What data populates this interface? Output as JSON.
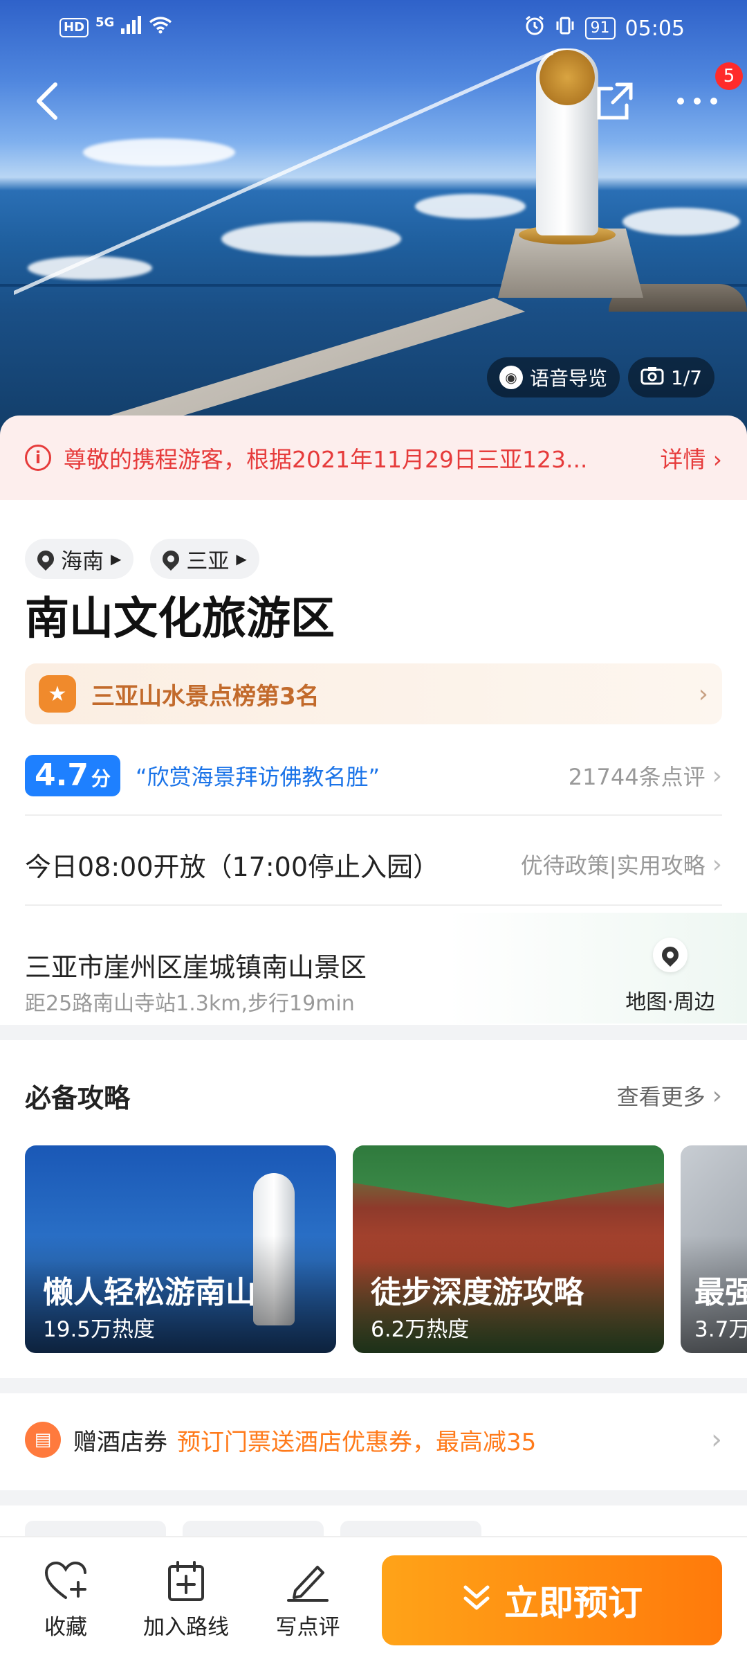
{
  "status_bar": {
    "left_badges": [
      "HD",
      "5G"
    ],
    "battery": "91",
    "time": "05:05"
  },
  "hero": {
    "notification_count": "5",
    "audio_guide_label": "语音导览",
    "photo_counter": "1/7"
  },
  "notice": {
    "text": "尊敬的携程游客，根据2021年11月29日三亚123...",
    "detail_label": "详情"
  },
  "location": {
    "province": "海南",
    "city": "三亚"
  },
  "attraction": {
    "title": "南山文化旅游区",
    "rank_label": "三亚山水景点榜第3名",
    "score": "4.7",
    "score_unit": "分",
    "quote": "“欣赏海景拜访佛教名胜”",
    "reviews": "21744条点评"
  },
  "hours": {
    "text": "今日08:00开放（17:00停止入园）",
    "links": "优待政策|实用攻略"
  },
  "address": {
    "line1": "三亚市崖州区崖城镇南山景区",
    "line2": "距25路南山寺站1.3km,步行19min",
    "map_label": "地图·周边"
  },
  "guides": {
    "heading": "必备攻略",
    "more_label": "查看更多",
    "cards": [
      {
        "title": "懒人轻松游南山",
        "heat": "19.5万热度"
      },
      {
        "title": "徒步深度游攻略",
        "heat": "6.2万热度"
      },
      {
        "title": "最强",
        "heat": "3.7万"
      }
    ]
  },
  "hotel_coupon": {
    "label": "赠酒店券",
    "promo": "预订门票送酒店优惠券，最高减35"
  },
  "bottom_bar": {
    "favorite": "收藏",
    "add_route": "加入路线",
    "write_review": "写点评",
    "book_now": "立即预订"
  },
  "colors": {
    "accent_orange": "#ff8a0d",
    "score_blue": "#1e80ff",
    "notice_red": "#e63b3b"
  }
}
